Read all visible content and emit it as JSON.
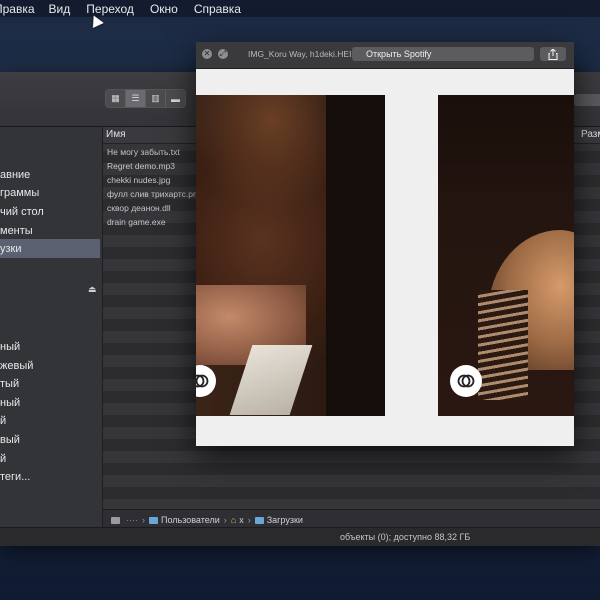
{
  "menubar": {
    "items": [
      "Правка",
      "Вид",
      "Переход",
      "Окно",
      "Справка"
    ]
  },
  "finder": {
    "sidebar": {
      "items": [
        "авние",
        "граммы",
        "чий стол",
        "менты",
        "узки",
        "ный",
        "жевый",
        "тый",
        "ный",
        "й",
        "вый",
        "й",
        "теги..."
      ],
      "selected_index": 4
    },
    "columns": {
      "name": "Имя",
      "size": "Разм"
    },
    "files": [
      "Не могу забыть.txt",
      "Regret demo.mp3",
      "chekki nudes.jpg",
      "фулл слив трихартс.png",
      "сквор деанон.dll",
      "drain game.exe"
    ],
    "path": {
      "dots": "····",
      "users": "Пользователи",
      "home": "x",
      "downloads": "Загрузки"
    },
    "status": "объекты (0); доступно 88,32 ГБ"
  },
  "quicklook": {
    "filename": "IMG_Koru Way, h1deki.HEIC",
    "open_button": "Открыть Spotify"
  },
  "icons": {
    "close": "close-icon",
    "fullscreen": "fullscreen-icon",
    "share": "share-icon",
    "live_photo": "live-photo-icon",
    "folder": "folder-icon",
    "home": "home-icon",
    "disk": "disk-icon",
    "eject": "eject-icon"
  },
  "colors": {
    "desktop": "#1c2a44",
    "sidebar_selection": "#5b6170",
    "folder": "#6aa6d8"
  }
}
